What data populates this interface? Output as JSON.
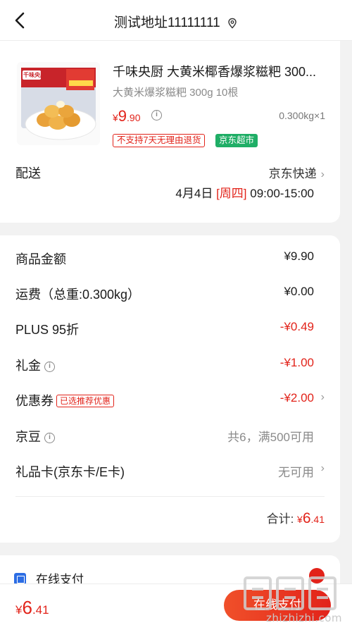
{
  "header": {
    "title": "测试地址11111111",
    "back_icon": "chevron-left-icon",
    "location_icon": "location-pin-icon"
  },
  "product": {
    "name": "千味央厨 大黄米椰香爆浆糍粑 300...",
    "spec": "大黄米爆浆糍粑 300g 10根",
    "price_currency": "¥",
    "price_int": "9",
    "price_dec": ".90",
    "quantity": "0.300kg×1",
    "tag_return": "不支持7天无理由退货",
    "tag_store": "京东超市",
    "image_brand_label": "千味央厨"
  },
  "delivery": {
    "label": "配送",
    "method": "京东快递",
    "date": "4月4日",
    "weekday": "[周四]",
    "time": "09:00-15:00"
  },
  "summary": {
    "rows": [
      {
        "label": "商品金额",
        "value": "¥9.90",
        "style": "dark"
      },
      {
        "label": "运费（总重:0.300kg）",
        "value": "¥0.00",
        "style": "dark"
      },
      {
        "label": "PLUS 95折",
        "value": "-¥0.49",
        "style": "red"
      },
      {
        "label": "礼金",
        "value": "-¥1.00",
        "style": "red"
      },
      {
        "label": "优惠券",
        "value": "-¥2.00",
        "style": "red",
        "tag": "已选推荐优惠"
      },
      {
        "label": "京豆",
        "value": "共6，满500可用",
        "style": "gray"
      },
      {
        "label": "礼品卡(京东卡/E卡)",
        "value": "无可用",
        "style": "gray"
      }
    ],
    "total_label": "合计:",
    "total_currency": "¥",
    "total_int": "6",
    "total_dec": ".41"
  },
  "payment": {
    "method_label": "在线支付"
  },
  "bottom": {
    "currency": "¥",
    "price_int": "6",
    "price_dec": ".41",
    "pay_button": "在线支付"
  },
  "watermark": {
    "text": "zhizhizhi.com"
  },
  "colors": {
    "accent_red": "#e2231a",
    "green_tag": "#1fae66",
    "pay_icon_blue": "#2c6de4"
  }
}
